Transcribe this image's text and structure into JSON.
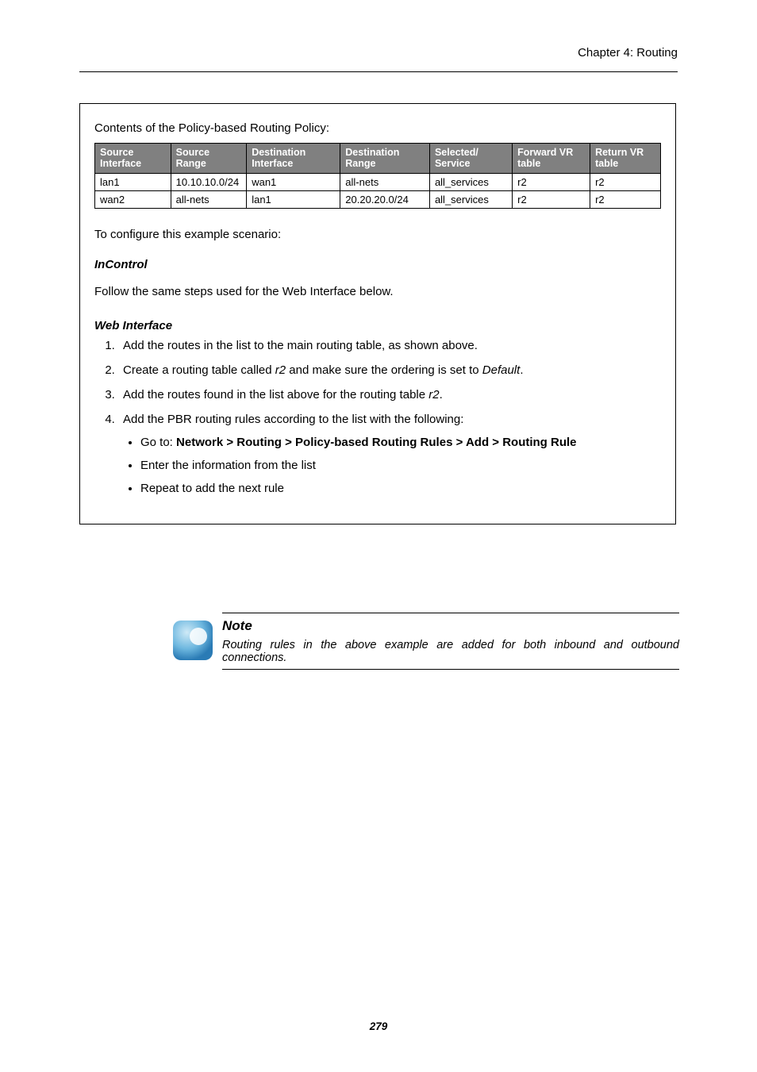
{
  "header": {
    "chapter": "Chapter 4: Routing"
  },
  "box": {
    "intro": "Contents of the Policy-based Routing Policy:",
    "table": {
      "headers": {
        "src_if": "Source Interface",
        "src_range": "Source Range",
        "dst_if": "Destination Interface",
        "dst_range": "Destination Range",
        "service": "Selected/ Service",
        "fwd": "Forward VR table",
        "ret": "Return VR table"
      },
      "rows": [
        {
          "src_if": "lan1",
          "src_range": "10.10.10.0/24",
          "dst_if": "wan1",
          "dst_range": "all-nets",
          "service": "all_services",
          "fwd": "r2",
          "ret": "r2"
        },
        {
          "src_if": "wan2",
          "src_range": "all-nets",
          "dst_if": "lan1",
          "dst_range": "20.20.20.0/24",
          "service": "all_services",
          "fwd": "r2",
          "ret": "r2"
        }
      ]
    },
    "configure_line": "To configure this example scenario:",
    "incontrol": {
      "label": "InControl",
      "text": "Follow the same steps used for the Web Interface below."
    },
    "webif": {
      "label": "Web Interface",
      "steps": {
        "s1": "Add the routes in the list to the main routing table, as shown above.",
        "s2a": "Create a routing table called ",
        "s2b": "r2",
        "s2c": " and make sure the ordering is set to ",
        "s2d": "Default",
        "s2e": ".",
        "s3a": "Add the routes found in the list above for the routing table ",
        "s3b": "r2",
        "s3c": ".",
        "s4": "Add the PBR routing rules according to the list with the following:",
        "sub1a": "Go to: ",
        "sub1b": "Network > Routing > Policy-based Routing Rules > Add > Routing Rule",
        "sub2": "Enter the information from the list",
        "sub3": "Repeat to add the next rule"
      }
    }
  },
  "note": {
    "title": "Note",
    "body": "Routing rules in the above example are added for both inbound and outbound connections."
  },
  "page_number": "279"
}
